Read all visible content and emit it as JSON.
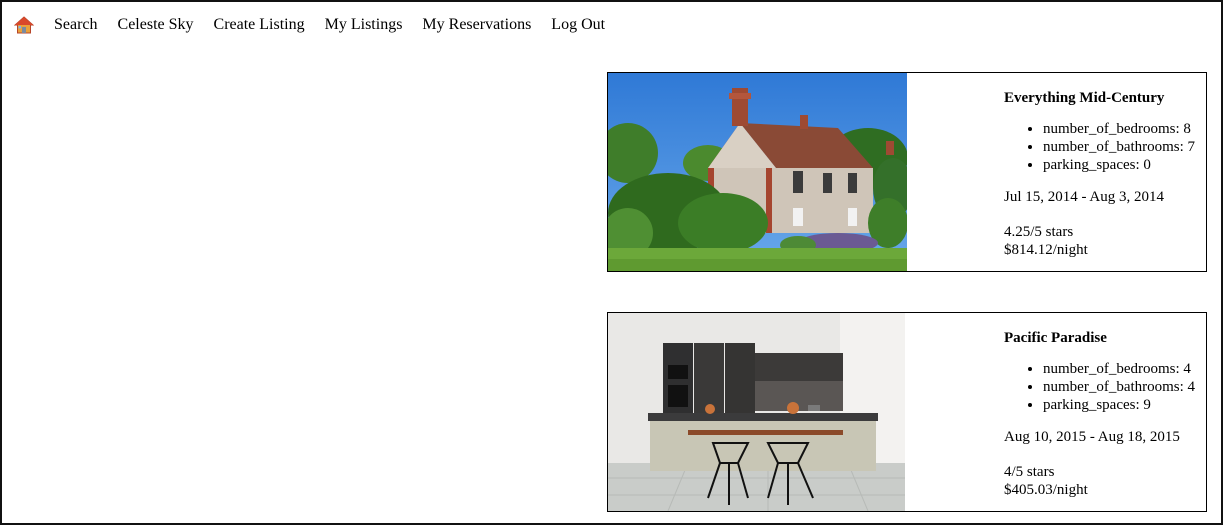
{
  "nav": {
    "home_icon": "house-icon",
    "links": [
      {
        "label": "Search"
      },
      {
        "label": "Celeste Sky"
      },
      {
        "label": "Create Listing"
      },
      {
        "label": "My Listings"
      },
      {
        "label": "My Reservations"
      },
      {
        "label": "Log Out"
      }
    ]
  },
  "listings": [
    {
      "title": "Everything Mid-Century",
      "features": [
        "number_of_bedrooms: 8",
        "number_of_bathrooms: 7",
        "parking_spaces: 0"
      ],
      "dates": "Jul 15, 2014 - Aug 3, 2014",
      "rating": "4.25/5 stars",
      "price": "$814.12/night",
      "image": "brick-cottage-photo"
    },
    {
      "title": "Pacific Paradise",
      "features": [
        "number_of_bedrooms: 4",
        "number_of_bathrooms: 4",
        "parking_spaces: 9"
      ],
      "dates": "Aug 10, 2015 - Aug 18, 2015",
      "rating": "4/5 stars",
      "price": "$405.03/night",
      "image": "modern-kitchen-photo"
    }
  ],
  "colors": {
    "border": "#000000",
    "home_icon_roof": "#d9482b",
    "home_icon_wall": "#f0b429"
  }
}
